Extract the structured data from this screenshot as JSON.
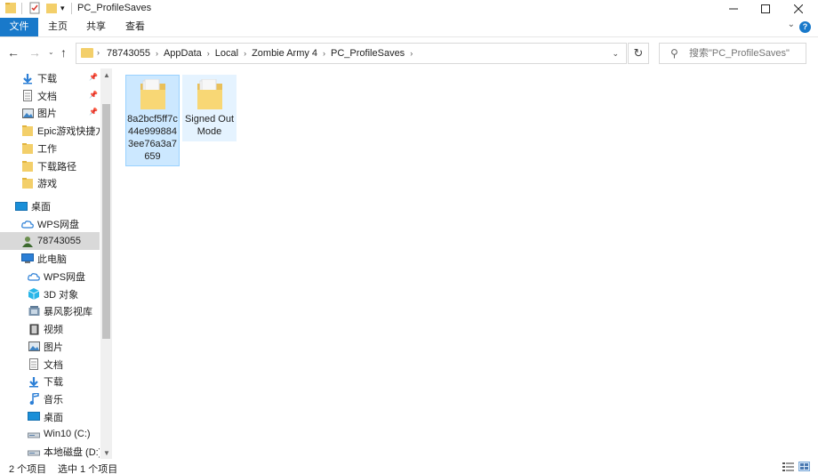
{
  "window": {
    "title": "PC_ProfileSaves",
    "minimize_icon": "minimize-icon",
    "maximize_icon": "maximize-icon",
    "close_icon": "close-icon"
  },
  "ribbon": {
    "tabs": [
      "文件",
      "共享",
      "查看"
    ],
    "home_tab": "主页",
    "accent": "#1979ca"
  },
  "address": {
    "crumbs": [
      "78743055",
      "AppData",
      "Local",
      "Zombie Army 4",
      "PC_ProfileSaves"
    ]
  },
  "search": {
    "placeholder": "搜索\"PC_ProfileSaves\""
  },
  "nav": {
    "quick_access": [
      {
        "label": "下载",
        "icon": "download-icon",
        "pinned": true
      },
      {
        "label": "文档",
        "icon": "document-icon",
        "pinned": true
      },
      {
        "label": "图片",
        "icon": "picture-icon",
        "pinned": true
      },
      {
        "label": "Epic游戏快捷方式",
        "icon": "folder-icon",
        "pinned": false
      },
      {
        "label": "工作",
        "icon": "folder-icon",
        "pinned": false
      },
      {
        "label": "下载路径",
        "icon": "folder-icon",
        "pinned": false
      },
      {
        "label": "游戏",
        "icon": "folder-icon",
        "pinned": false
      }
    ],
    "desktop": "桌面",
    "wps_cloud": "WPS网盘",
    "user": "78743055",
    "this_pc": "此电脑",
    "pc_items": [
      {
        "label": "WPS网盘",
        "icon": "cloud-icon"
      },
      {
        "label": "3D 对象",
        "icon": "cube-icon"
      },
      {
        "label": "暴风影视库",
        "icon": "media-library-icon"
      },
      {
        "label": "视频",
        "icon": "video-icon"
      },
      {
        "label": "图片",
        "icon": "picture-icon"
      },
      {
        "label": "文档",
        "icon": "document-icon"
      },
      {
        "label": "下载",
        "icon": "download-icon"
      },
      {
        "label": "音乐",
        "icon": "music-icon"
      },
      {
        "label": "桌面",
        "icon": "desktop-icon"
      },
      {
        "label": "Win10 (C:)",
        "icon": "drive-icon"
      },
      {
        "label": "本地磁盘 (D:)",
        "icon": "drive-icon"
      }
    ]
  },
  "files": [
    {
      "name": "8a2bcf5ff7c44e9998843ee76a3a7659",
      "selected": true
    },
    {
      "name": "Signed Out Mode",
      "selected": false
    }
  ],
  "status": {
    "count": "2 个项目",
    "selected": "选中 1 个项目"
  }
}
